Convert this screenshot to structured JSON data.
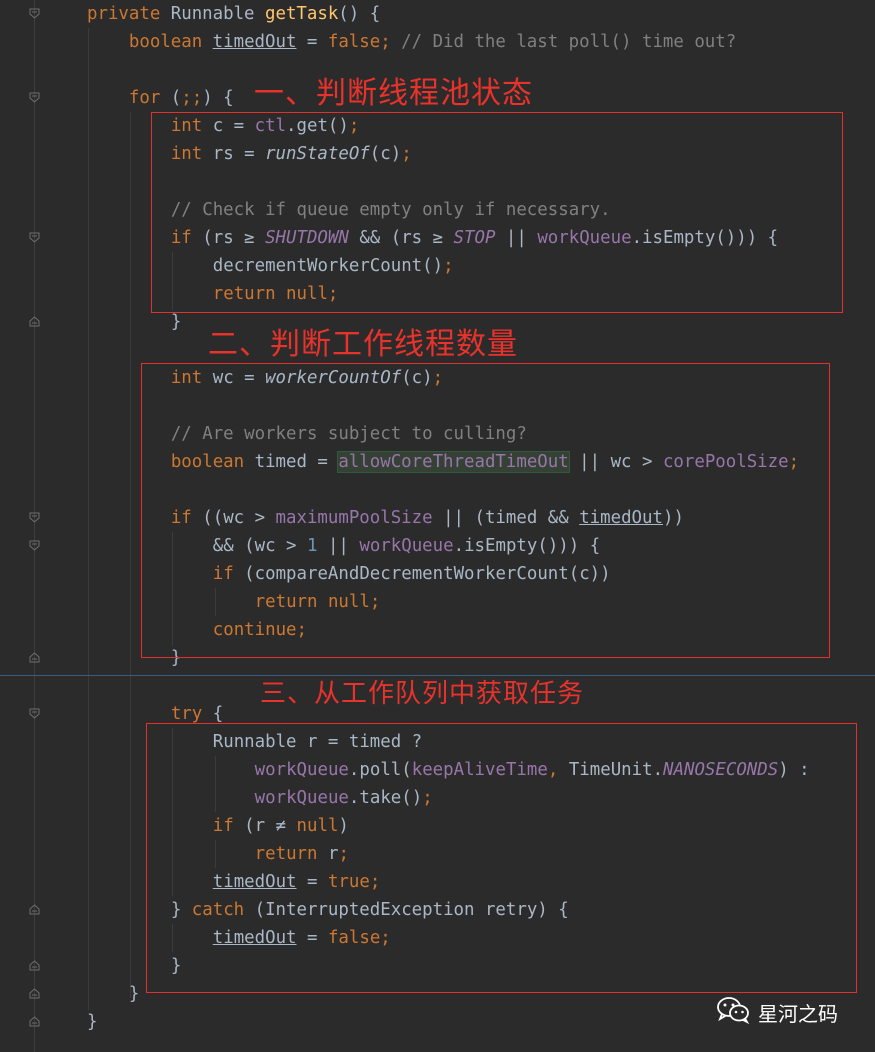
{
  "lines": [
    {
      "seg": [
        [
          "kw",
          "private "
        ],
        [
          "",
          "Runnable "
        ],
        [
          "fn",
          "getTask"
        ],
        [
          "",
          "() {"
        ]
      ]
    },
    {
      "seg": [
        [
          "kw",
          "boolean "
        ],
        [
          "under",
          "timedOut"
        ],
        [
          "",
          " = "
        ],
        [
          "kw",
          "false;"
        ],
        [
          "cmt",
          " // Did the last poll() time out?"
        ]
      ]
    },
    {
      "seg": []
    },
    {
      "seg": [
        [
          "kw",
          "for "
        ],
        [
          "",
          "("
        ],
        [
          "kw",
          ";;"
        ],
        [
          "",
          ") {"
        ]
      ]
    },
    {
      "seg": [
        [
          "kw",
          "int "
        ],
        [
          "",
          "c = "
        ],
        [
          "field",
          "ctl"
        ],
        [
          "",
          ".get()"
        ],
        [
          "kw",
          ";"
        ]
      ]
    },
    {
      "seg": [
        [
          "kw",
          "int "
        ],
        [
          "",
          "rs = "
        ],
        [
          "ital",
          "runStateOf"
        ],
        [
          "",
          "(c)"
        ],
        [
          "kw",
          ";"
        ]
      ]
    },
    {
      "seg": []
    },
    {
      "seg": [
        [
          "cmt",
          "// Check if queue empty only if necessary."
        ]
      ]
    },
    {
      "seg": [
        [
          "kw",
          "if "
        ],
        [
          "",
          "(rs ≥ "
        ],
        [
          "sfield",
          "SHUTDOWN"
        ],
        [
          "",
          " && (rs ≥ "
        ],
        [
          "sfield",
          "STOP"
        ],
        [
          "",
          " || "
        ],
        [
          "field",
          "workQueue"
        ],
        [
          "",
          ".isEmpty())) {"
        ]
      ]
    },
    {
      "seg": [
        [
          "",
          "decrementWorkerCount()"
        ],
        [
          "kw",
          ";"
        ]
      ]
    },
    {
      "seg": [
        [
          "kw",
          "return null;"
        ]
      ]
    },
    {
      "seg": [
        [
          "",
          "}"
        ]
      ]
    },
    {
      "seg": []
    },
    {
      "seg": [
        [
          "kw",
          "int "
        ],
        [
          "",
          "wc = "
        ],
        [
          "ital",
          "workerCountOf"
        ],
        [
          "",
          "(c)"
        ],
        [
          "kw",
          ";"
        ]
      ]
    },
    {
      "seg": []
    },
    {
      "seg": [
        [
          "cmt",
          "// Are workers subject to culling?"
        ]
      ]
    },
    {
      "seg": [
        [
          "kw",
          "boolean "
        ],
        [
          "",
          "timed = "
        ],
        [
          "fieldhl",
          "allowCoreThreadTimeOut"
        ],
        [
          "",
          " || wc > "
        ],
        [
          "field",
          "corePoolSize"
        ],
        [
          "kw",
          ";"
        ]
      ]
    },
    {
      "seg": []
    },
    {
      "seg": [
        [
          "kw",
          "if "
        ],
        [
          "",
          "((wc > "
        ],
        [
          "field",
          "maximumPoolSize"
        ],
        [
          "",
          " || (timed && "
        ],
        [
          "under",
          "timedOut"
        ],
        [
          "",
          "))"
        ]
      ]
    },
    {
      "seg": [
        [
          "",
          "&& (wc > "
        ],
        [
          "num",
          "1"
        ],
        [
          "",
          " || "
        ],
        [
          "field",
          "workQueue"
        ],
        [
          "",
          ".isEmpty())) {"
        ]
      ]
    },
    {
      "seg": [
        [
          "kw",
          "if "
        ],
        [
          "",
          "(compareAndDecrementWorkerCount(c))"
        ]
      ]
    },
    {
      "seg": [
        [
          "kw",
          "return null;"
        ]
      ]
    },
    {
      "seg": [
        [
          "kw",
          "continue;"
        ]
      ]
    },
    {
      "seg": [
        [
          "",
          "}"
        ]
      ]
    },
    {
      "seg": []
    },
    {
      "seg": [
        [
          "kw",
          "try "
        ],
        [
          "",
          "{"
        ]
      ]
    },
    {
      "seg": [
        [
          "",
          "Runnable r = timed ?"
        ]
      ]
    },
    {
      "seg": [
        [
          "field",
          "workQueue"
        ],
        [
          "",
          ".poll("
        ],
        [
          "field",
          "keepAliveTime"
        ],
        [
          "kw",
          ", "
        ],
        [
          "",
          "TimeUnit."
        ],
        [
          "sfield",
          "NANOSECONDS"
        ],
        [
          "",
          ") :"
        ]
      ]
    },
    {
      "seg": [
        [
          "field",
          "workQueue"
        ],
        [
          "",
          ".take()"
        ],
        [
          "kw",
          ";"
        ]
      ]
    },
    {
      "seg": [
        [
          "kw",
          "if "
        ],
        [
          "",
          "(r ≠ "
        ],
        [
          "kw",
          "null"
        ],
        [
          "",
          ")"
        ]
      ]
    },
    {
      "seg": [
        [
          "kw",
          "return "
        ],
        [
          "",
          "r"
        ],
        [
          "kw",
          ";"
        ]
      ]
    },
    {
      "seg": [
        [
          "under",
          "timedOut"
        ],
        [
          "",
          " = "
        ],
        [
          "kw",
          "true;"
        ]
      ]
    },
    {
      "seg": [
        [
          "",
          "} "
        ],
        [
          "kw",
          "catch "
        ],
        [
          "",
          "(InterruptedException retry) {"
        ]
      ]
    },
    {
      "seg": [
        [
          "under",
          "timedOut"
        ],
        [
          "",
          " = "
        ],
        [
          "kw",
          "false;"
        ]
      ]
    },
    {
      "seg": [
        [
          "",
          "}"
        ]
      ]
    },
    {
      "seg": [
        [
          "",
          "}"
        ]
      ]
    },
    {
      "seg": [
        [
          "",
          "}"
        ]
      ]
    }
  ],
  "annotations": {
    "step1": "一、判断线程池状态",
    "step2": "二、判断工作线程数量",
    "step3": "三、从工作队列中获取任务"
  },
  "watermark": {
    "text": "星河之码",
    "icon": "wechat-icon"
  },
  "colors": {
    "background": "#2b2b2b",
    "keyword": "#cc7832",
    "method": "#ffc66d",
    "field": "#9876aa",
    "comment": "#808080",
    "number": "#6897bb",
    "text": "#a9b7c6",
    "annotation": "#e8322c"
  }
}
